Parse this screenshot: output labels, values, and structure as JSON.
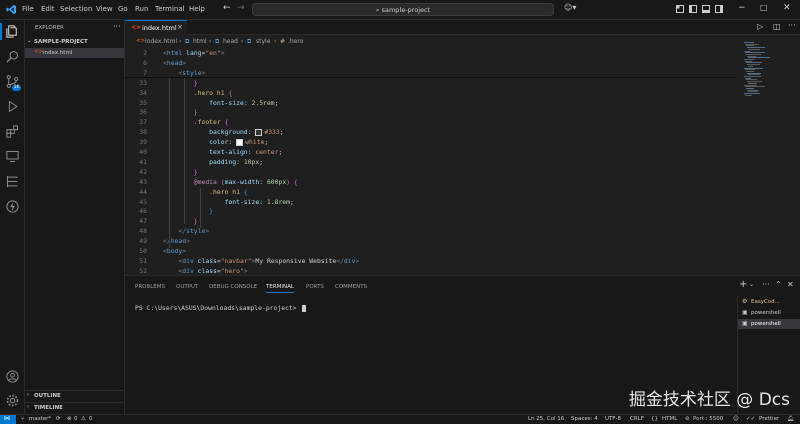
{
  "menu": [
    "File",
    "Edit",
    "Selection",
    "View",
    "Go",
    "Run",
    "Terminal",
    "Help"
  ],
  "search": {
    "text": "sample-project"
  },
  "sidebar": {
    "title": "EXPLORER",
    "project": "SAMPLE-PROJECT",
    "files": [
      {
        "name": "index.html",
        "icon": "html-file-icon"
      }
    ],
    "outline": "OUTLINE",
    "timeline": "TIMELINE"
  },
  "editor": {
    "tab": "index.html",
    "breadcrumb": [
      "index.html",
      "html",
      "head",
      "style",
      ".hero"
    ],
    "lines": [
      {
        "n": "2",
        "html": "<span class='t-gray'>&lt;</span><span class='t-tag'>html</span> <span class='t-attr'>lang</span>=<span class='t-str'>\"en\"</span><span class='t-gray'>&gt;</span>"
      },
      {
        "n": "6",
        "html": "<span class='t-gray'>&lt;</span><span class='t-tag'>head</span><span class='t-gray'>&gt;</span>"
      },
      {
        "n": "7",
        "html": "    <span class='t-gray'>&lt;</span><span class='t-tag'>style</span><span class='t-gray'>&gt;</span>"
      },
      {
        "n": "33",
        "html": "        <span class='t-br2'>}</span>"
      },
      {
        "n": "34",
        "html": "        <span class='t-sel'>.hero h1</span> <span class='t-br2'>{</span>"
      },
      {
        "n": "35",
        "html": "            <span class='t-prop'>font-size</span>: <span class='t-num'>2.5rem</span>;"
      },
      {
        "n": "36",
        "html": "        <span class='t-br2'>}</span>"
      },
      {
        "n": "37",
        "html": "        <span class='t-sel'>.footer</span> <span class='t-br2'>{</span>"
      },
      {
        "n": "38",
        "html": "            <span class='t-prop'>background</span>: <span class='swatch' style='background:#333333'></span><span class='t-val'>#333</span>;"
      },
      {
        "n": "39",
        "html": "            <span class='t-prop'>color</span>: <span class='swatch' style='background:#ffffff'></span><span class='t-val'>white</span>;"
      },
      {
        "n": "40",
        "html": "            <span class='t-prop'>text-align</span>: <span class='t-val'>center</span>;"
      },
      {
        "n": "41",
        "html": "            <span class='t-prop'>padding</span>: <span class='t-num'>10px</span>;"
      },
      {
        "n": "42",
        "html": "        <span class='t-br2'>}</span>"
      },
      {
        "n": "43",
        "html": "        <span class='t-kw'>@media</span> <span class='t-br2'>(</span><span class='t-prop'>max-width</span>: <span class='t-num'>600px</span><span class='t-br2'>)</span> <span class='t-br2'>{</span>"
      },
      {
        "n": "44",
        "html": "            <span class='t-sel'>.hero h1</span> <span class='t-br3'>{</span>"
      },
      {
        "n": "45",
        "html": "                <span class='t-prop'>font-size</span>: <span class='t-num'>1.8rem</span>;"
      },
      {
        "n": "46",
        "html": "            <span class='t-br3'>}</span>"
      },
      {
        "n": "47",
        "html": "        <span class='t-br2'>}</span>"
      },
      {
        "n": "48",
        "html": "    <span class='t-gray'>&lt;/</span><span class='t-tag'>style</span><span class='t-gray'>&gt;</span>"
      },
      {
        "n": "49",
        "html": "<span class='t-gray'>&lt;/</span><span class='t-tag'>head</span><span class='t-gray'>&gt;</span>"
      },
      {
        "n": "50",
        "html": "<span class='t-gray'>&lt;</span><span class='t-tag'>body</span><span class='t-gray'>&gt;</span>"
      },
      {
        "n": "51",
        "html": "    <span class='t-gray'>&lt;</span><span class='t-tag'>div</span> <span class='t-attr'>class</span>=<span class='t-str'>\"navbar\"</span><span class='t-gray'>&gt;</span>My Responsive Website<span class='t-gray'>&lt;/</span><span class='t-tag'>div</span><span class='t-gray'>&gt;</span>"
      },
      {
        "n": "52",
        "html": "    <span class='t-gray'>&lt;</span><span class='t-tag'>div</span> <span class='t-attr'>class</span>=<span class='t-str'>\"hero\"</span><span class='t-gray'>&gt;</span>"
      }
    ]
  },
  "panel": {
    "tabs": [
      "PROBLEMS",
      "OUTPUT",
      "DEBUG CONSOLE",
      "TERMINAL",
      "PORTS",
      "COMMENTS"
    ],
    "active_tab": "TERMINAL",
    "prompt": "PS C:\\Users\\ASUS\\Downloads\\sample-project> ",
    "terminals": [
      "EasyCod...",
      "powershell",
      "powershell"
    ]
  },
  "status": {
    "branch": "master*",
    "errors": "0",
    "warnings": "0",
    "cursor": "Ln 25, Col 16",
    "spaces": "Spaces: 4",
    "encoding": "UTF-8",
    "eol": "CRLF",
    "language": "HTML",
    "port": "Port : 5500",
    "prettier": "Prettier"
  },
  "watermark": "掘金技术社区 @ Dcs",
  "colors": {
    "accent": "#0078d4",
    "bg": "#1f1f1f",
    "panel": "#181818"
  }
}
